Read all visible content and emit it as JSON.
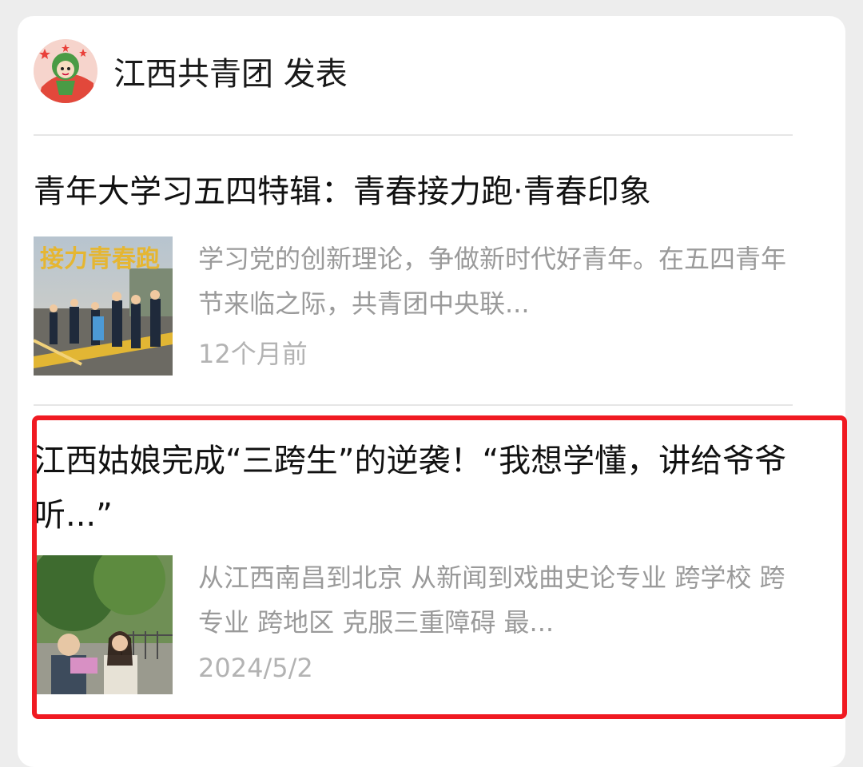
{
  "account": {
    "name": "江西共青团",
    "action": "发表",
    "avatar_icon": "mascot-avatar"
  },
  "articles": [
    {
      "title": "青年大学习五四特辑：青春接力跑·青春印象",
      "summary": "学习党的创新理论，争做新时代好青年。在五四青年节来临之际，共青团中央联...",
      "date": "12个月前",
      "thumb_text": "接力青春跑",
      "thumb_icon": "relay-run-photo"
    },
    {
      "title": "江西姑娘完成“三跨生”的逆袭！“我想学懂，讲给爷爷听...”",
      "summary": "从江西南昌到北京 从新闻到戏曲史论专业 跨学校 跨专业 跨地区 克服三重障碍 最...",
      "date": "2024/5/2",
      "thumb_icon": "grandpa-granddaughter-photo"
    }
  ],
  "highlight": {
    "color": "#f01a22"
  }
}
